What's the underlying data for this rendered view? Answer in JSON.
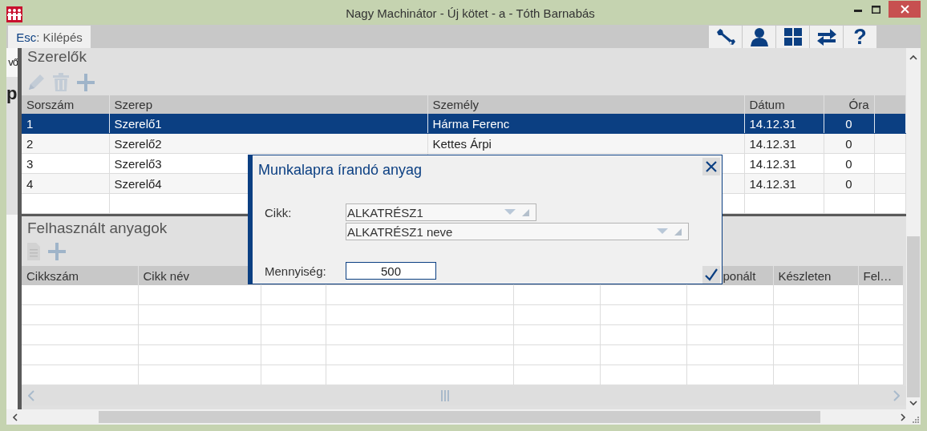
{
  "window": {
    "title": "Nagy Machinátor - Új kötet - a - Tóth Barnabás"
  },
  "toolbar": {
    "escape_key": "Esc",
    "escape_label": ": Kilépés",
    "buttons": [
      {
        "kind": "wrench"
      },
      {
        "kind": "user"
      },
      {
        "kind": "grid"
      },
      {
        "kind": "swap"
      },
      {
        "kind": "help",
        "text": "?"
      }
    ]
  },
  "left_strip": {
    "text_1": "vő",
    "text_2": "p"
  },
  "mechanics": {
    "title": "Szerelők",
    "tools": [
      {
        "kind": "edit"
      },
      {
        "kind": "delete"
      },
      {
        "kind": "add"
      }
    ],
    "columns": [
      "Sorszám",
      "Szerep",
      "Személy",
      "Dátum",
      "Óra"
    ],
    "rows": [
      {
        "selected": true,
        "number": "1",
        "role": "Szerelő1",
        "person": "Hárma Ferenc",
        "date": "14.12.31",
        "hours": "0"
      },
      {
        "selected": false,
        "number": "2",
        "role": "Szerelő2",
        "person": "Kettes Árpi",
        "date": "14.12.31",
        "hours": "0"
      },
      {
        "selected": false,
        "number": "3",
        "role": "Szerelő3",
        "date": "14.12.31",
        "hours": "0"
      },
      {
        "selected": false,
        "number": "4",
        "role": "Szerelő4",
        "date": "14.12.31",
        "hours": "0"
      }
    ]
  },
  "materials": {
    "title": "Felhasznált anyagok",
    "tools": [
      {
        "kind": "document"
      },
      {
        "kind": "add"
      }
    ],
    "columns": [
      "Cikkszám",
      "Cikk név",
      null,
      null,
      null,
      null,
      "ponált",
      "Készleten",
      "Fel…"
    ]
  },
  "dialog": {
    "title": "Munkalapra írandó anyag",
    "article_label": "Cikk:",
    "article_code": "ALKATRÉSZ1",
    "article_name": "ALKATRÉSZ1 neve",
    "quantity_label": "Mennyiség:",
    "quantity": "500"
  }
}
